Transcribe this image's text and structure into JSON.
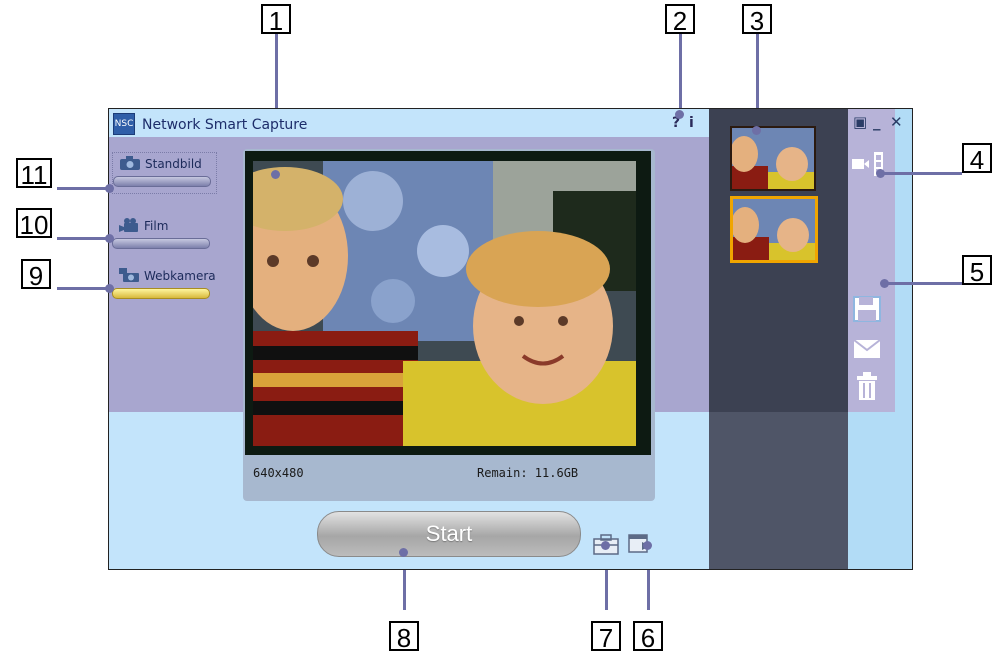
{
  "window": {
    "title": "Network Smart Capture",
    "help_label": "?",
    "info_label": "i",
    "restore_label": "▣",
    "minimize_label": "_",
    "close_label": "✕"
  },
  "modes": [
    {
      "label": "Standbild",
      "icon": "camera-icon",
      "active": false
    },
    {
      "label": "Film",
      "icon": "film-camera-icon",
      "active": false
    },
    {
      "label": "Webkamera",
      "icon": "webcam-icon",
      "active": true
    }
  ],
  "preview": {
    "resolution": "640x480",
    "remain": "Remain: 11.6GB"
  },
  "start_button": {
    "label": "Start"
  },
  "thumbnails": [
    {
      "selected": false
    },
    {
      "selected": true
    }
  ],
  "callouts": [
    "1",
    "2",
    "3",
    "4",
    "5",
    "6",
    "7",
    "8",
    "9",
    "10",
    "11"
  ],
  "colors": {
    "accent": "#f0a500",
    "window_bg": "#c3e4fb",
    "band": "#a8a6cf",
    "callout_line": "#6e6fa6"
  }
}
